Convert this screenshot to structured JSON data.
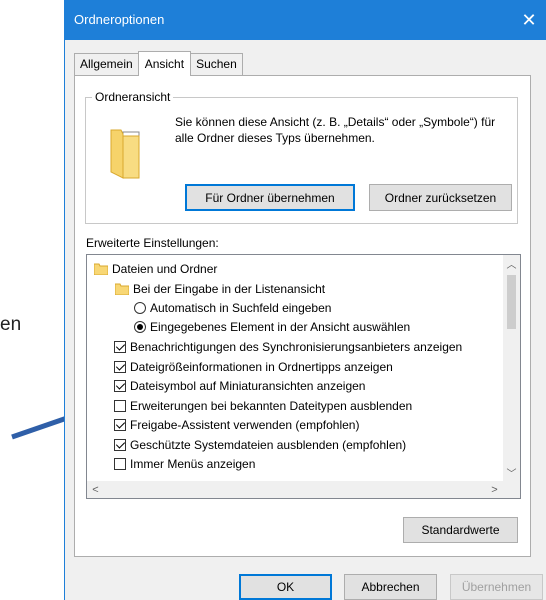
{
  "background": {
    "fragment_text": "en"
  },
  "dialog": {
    "title": "Ordneroptionen",
    "close_symbol": "✕",
    "tabs": [
      {
        "label": "Allgemein"
      },
      {
        "label": "Ansicht"
      },
      {
        "label": "Suchen"
      }
    ],
    "folder_view": {
      "legend": "Ordneransicht",
      "description": "Sie können diese Ansicht (z. B. „Details“ oder „Symbole“) für alle Ordner dieses Typs übernehmen.",
      "apply_button": "Für Ordner übernehmen",
      "reset_button": "Ordner zurücksetzen"
    },
    "advanced_label": "Erweiterte Einstellungen:",
    "tree_items": [
      {
        "type": "folder",
        "label": "Dateien und Ordner"
      },
      {
        "type": "folder",
        "label": "Bei der Eingabe in der Listenansicht"
      },
      {
        "type": "radio",
        "checked": false,
        "label": "Automatisch in Suchfeld eingeben"
      },
      {
        "type": "radio",
        "checked": true,
        "label": "Eingegebenes Element in der Ansicht auswählen"
      },
      {
        "type": "checkbox",
        "checked": true,
        "label": "Benachrichtigungen des Synchronisierungsanbieters anzeigen"
      },
      {
        "type": "checkbox",
        "checked": true,
        "label": "Dateigrößeinformationen in Ordnertipps anzeigen"
      },
      {
        "type": "checkbox",
        "checked": true,
        "label": "Dateisymbol auf Miniaturansichten anzeigen"
      },
      {
        "type": "checkbox",
        "checked": false,
        "label": "Erweiterungen bei bekannten Dateitypen ausblenden"
      },
      {
        "type": "checkbox",
        "checked": true,
        "label": "Freigabe-Assistent verwenden (empfohlen)"
      },
      {
        "type": "checkbox",
        "checked": true,
        "label": "Geschützte Systemdateien ausblenden (empfohlen)"
      },
      {
        "type": "checkbox",
        "checked": false,
        "label": "Immer Menüs anzeigen"
      }
    ],
    "defaults_button": "Standardwerte",
    "ok_button": "OK",
    "cancel_button": "Abbrechen",
    "apply_button": "Übernehmen"
  },
  "colors": {
    "titlebar": "#1e7fd8",
    "arrow": "#2f5fa8",
    "default_button_border": "#0078d7"
  }
}
